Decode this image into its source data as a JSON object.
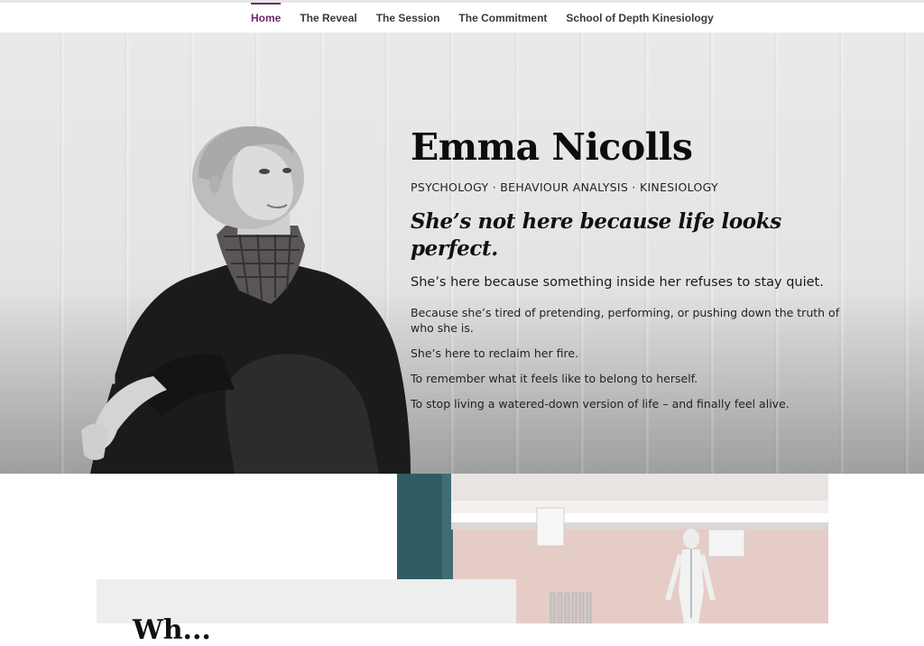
{
  "nav": {
    "items": [
      {
        "label": "Home",
        "active": true
      },
      {
        "label": "The Reveal",
        "active": false
      },
      {
        "label": "The Session",
        "active": false
      },
      {
        "label": "The Commitment",
        "active": false
      },
      {
        "label": "School of Depth Kinesiology",
        "active": false
      }
    ],
    "accent_color": "#6b2a6e"
  },
  "hero": {
    "name": "Emma Nicolls",
    "disciplines": "PSYCHOLOGY · BEHAVIOUR ANALYSIS · KINESIOLOGY",
    "tagline": "She’s not here because life looks perfect.",
    "subline": "She’s here because something inside her refuses to stay quiet.",
    "paragraphs": [
      "Because she’s tired of pretending, performing, or pushing down the truth of who she is.",
      "She’s here to reclaim her fire.",
      "To remember what it feels like to belong to herself.",
      "To stop living a watered-down version of life – and finally feel alive."
    ]
  },
  "section": {
    "heading": "Wh..."
  }
}
